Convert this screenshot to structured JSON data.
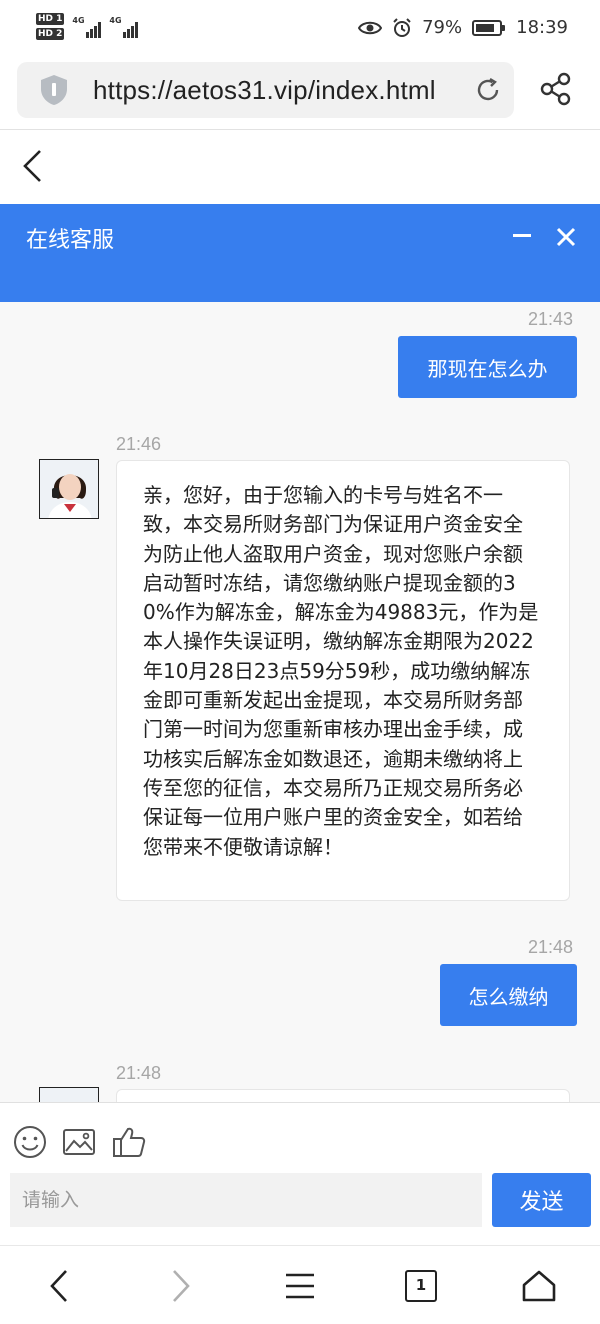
{
  "status_bar": {
    "hd1": "HD 1",
    "hd2": "HD 2",
    "network1": "4G",
    "network2": "4G",
    "battery_percent": "79%",
    "time": "18:39"
  },
  "browser": {
    "url": "https://aetos31.vip/index.html"
  },
  "chat": {
    "title": "在线客服",
    "messages": [
      {
        "time": "21:43",
        "from": "user",
        "text": "那现在怎么办"
      },
      {
        "time": "21:46",
        "from": "agent",
        "text": "亲，您好，由于您输入的卡号与姓名不一致，本交易所财务部门为保证用户资金安全为防止他人盗取用户资金，现对您账户余额启动暂时冻结，请您缴纳账户提现金额的30%作为解冻金，解冻金为49883元，作为是本人操作失误证明，缴纳解冻金期限为2022年10月28日23点59分59秒，成功缴纳解冻金即可重新发起出金提现，本交易所财务部门第一时间为您重新审核办理出金手续，成功核实后解冻金如数退还，逾期未缴纳将上传至您的征信，本交易所乃正规交易所务必保证每一位用户账户里的资金安全，如若给您带来不便敬请谅解！"
      },
      {
        "time": "21:48",
        "from": "user",
        "text": "怎么缴纳"
      },
      {
        "time": "21:48",
        "from": "agent",
        "text": ""
      }
    ]
  },
  "input": {
    "placeholder": "请输入",
    "send_label": "发送"
  },
  "bottom_nav": {
    "tab_count": "1"
  },
  "colors": {
    "accent": "#377eee",
    "bubble_left_bg": "#ffffff",
    "timestamp": "#a6a6a6"
  }
}
